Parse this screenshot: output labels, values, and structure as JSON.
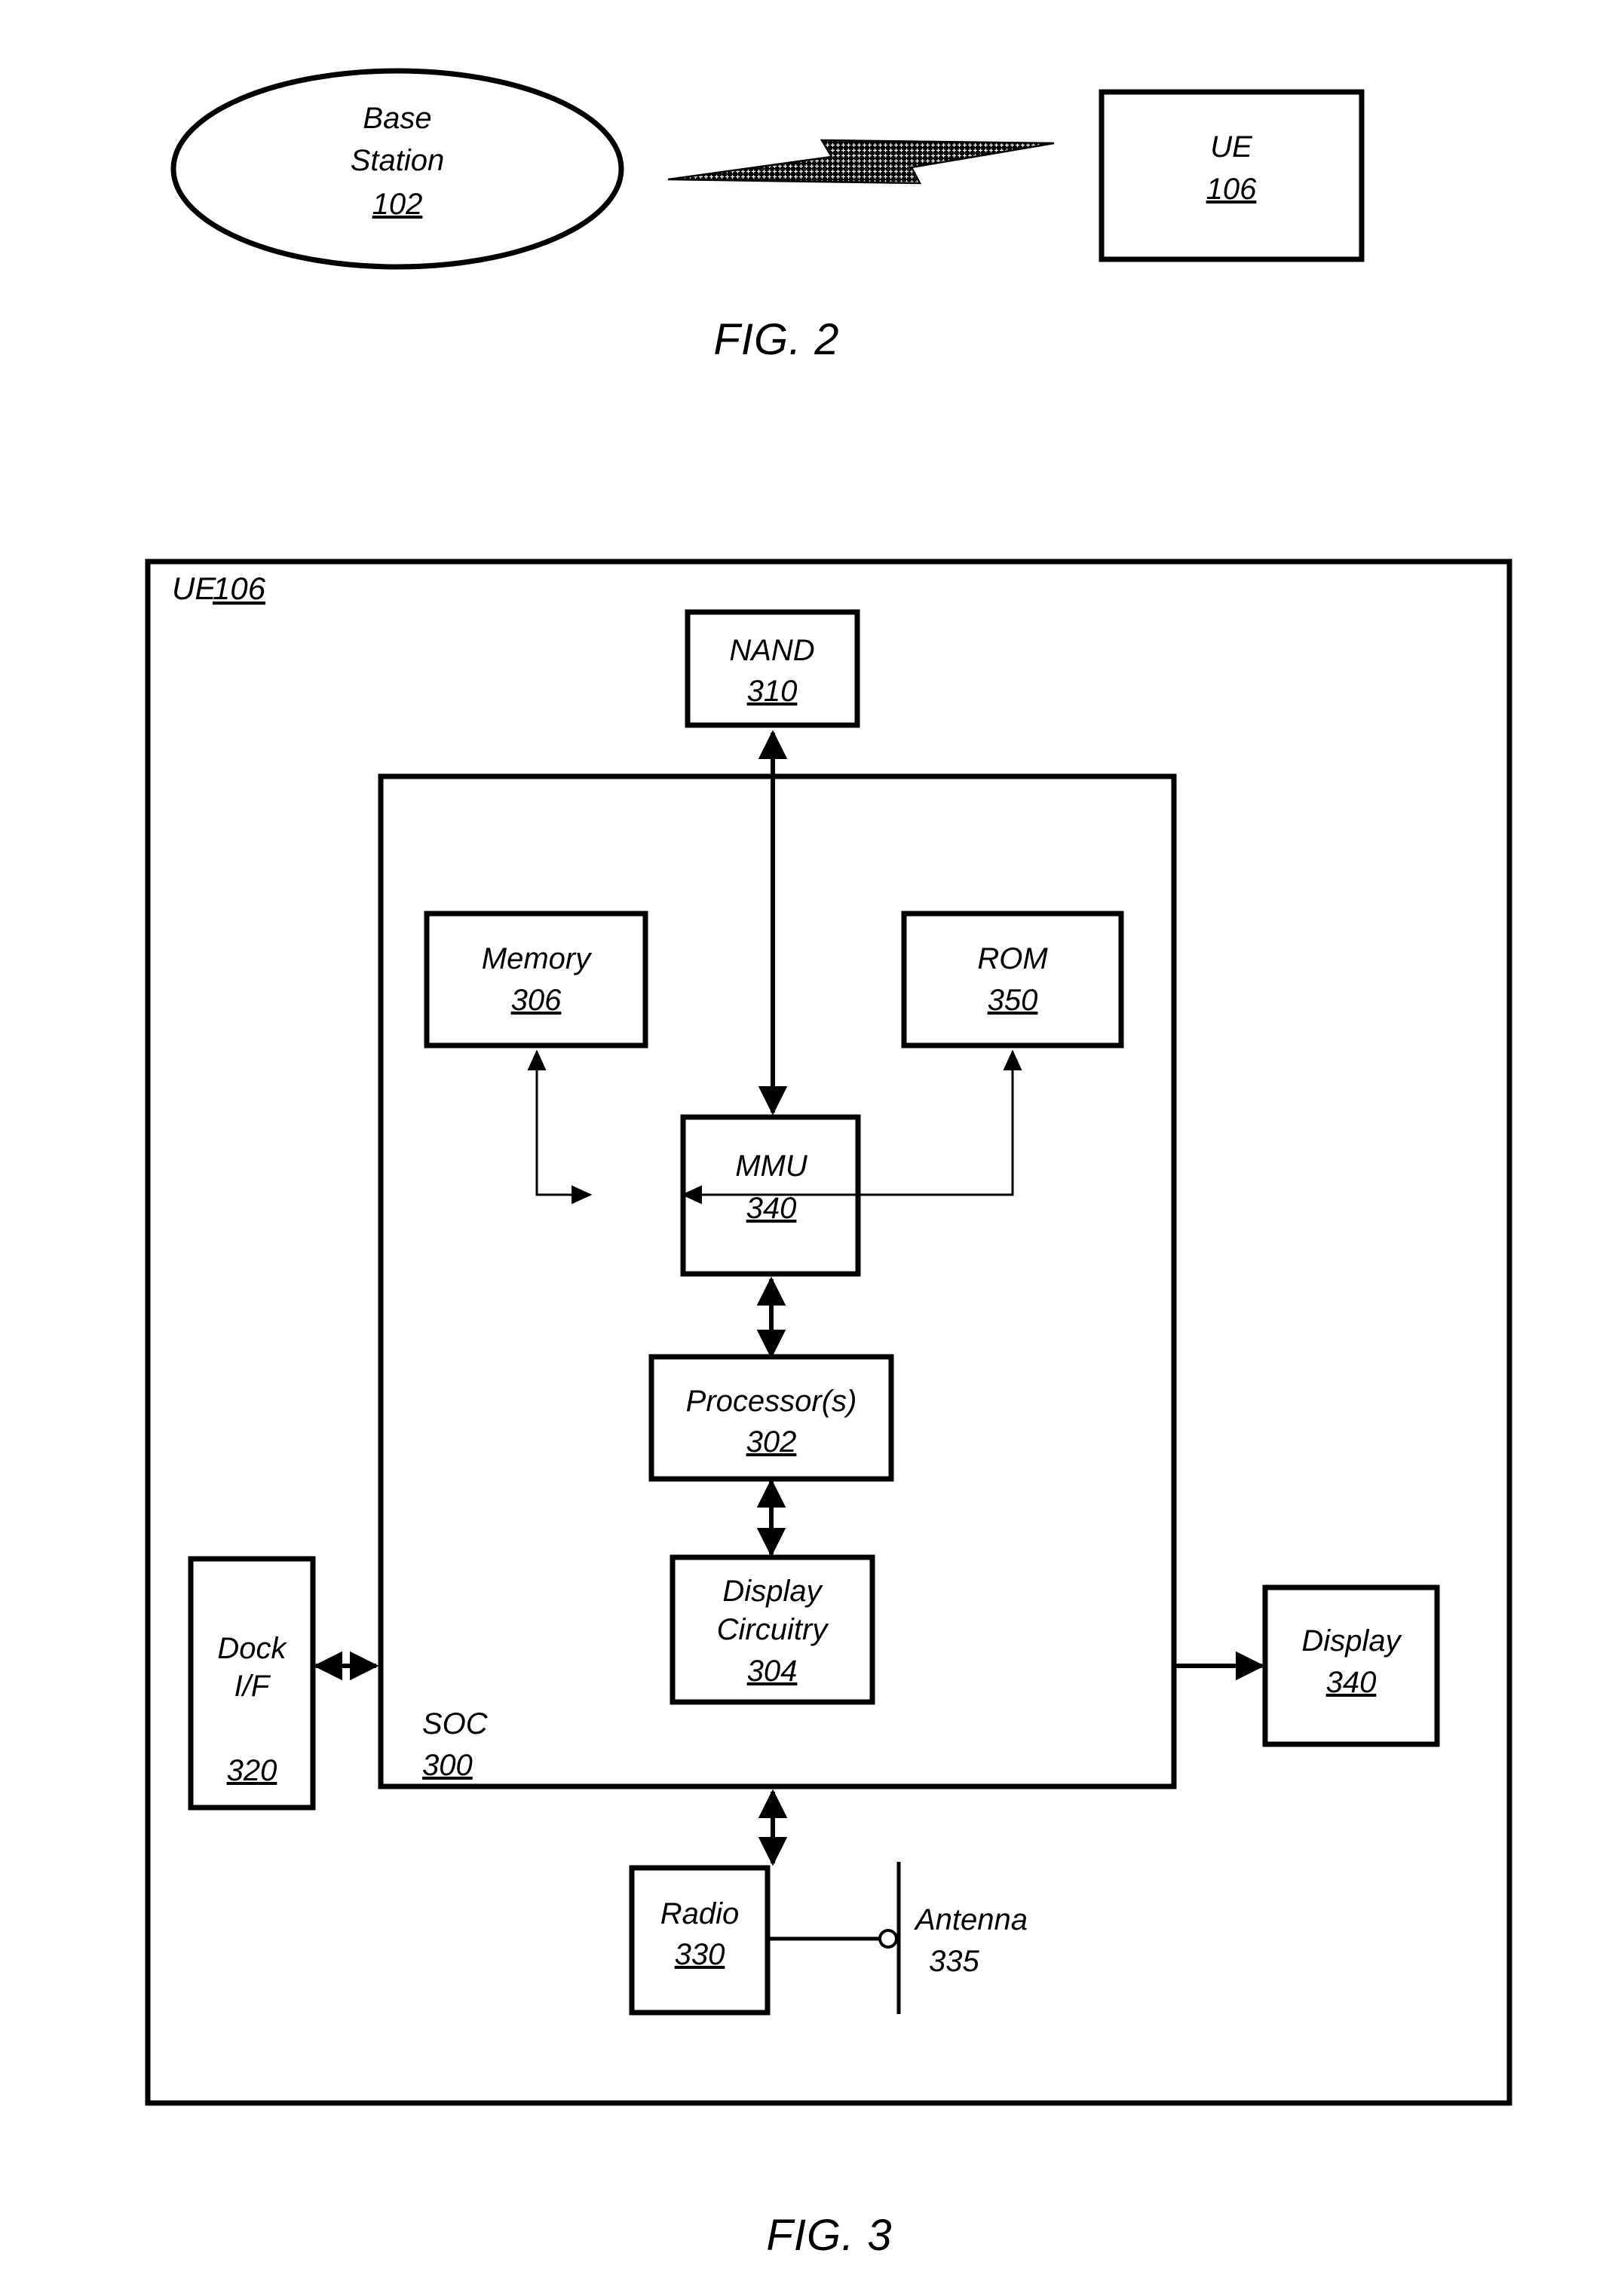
{
  "figure2": {
    "caption": "FIG. 2",
    "base_station": {
      "line1": "Base",
      "line2": "Station",
      "ref": "102"
    },
    "ue": {
      "line1": "UE",
      "ref": "106"
    },
    "link_icon": "lightning-bolt-icon"
  },
  "figure3": {
    "caption": "FIG. 3",
    "ue_container": {
      "label": "UE",
      "ref": "106"
    },
    "soc_container": {
      "label": "SOC",
      "ref": "300"
    },
    "blocks": {
      "nand": {
        "line1": "NAND",
        "line2": "",
        "ref": "310"
      },
      "memory": {
        "line1": "Memory",
        "line2": "",
        "ref": "306"
      },
      "rom": {
        "line1": "ROM",
        "line2": "",
        "ref": "350"
      },
      "mmu": {
        "line1": "MMU",
        "line2": "",
        "ref": "340"
      },
      "processor": {
        "line1": "Processor(s)",
        "line2": "",
        "ref": "302"
      },
      "display_circuitry": {
        "line1": "Display",
        "line2": "Circuitry",
        "ref": "304"
      },
      "dock": {
        "line1": "Dock",
        "line2": "I/F",
        "ref": "320"
      },
      "display": {
        "line1": "Display",
        "line2": "",
        "ref": "340"
      },
      "radio": {
        "line1": "Radio",
        "line2": "",
        "ref": "330"
      },
      "antenna": {
        "line1": "Antenna",
        "line2": "",
        "ref": "335"
      }
    }
  },
  "colors": {
    "ink": "#000000",
    "paper": "#ffffff"
  }
}
